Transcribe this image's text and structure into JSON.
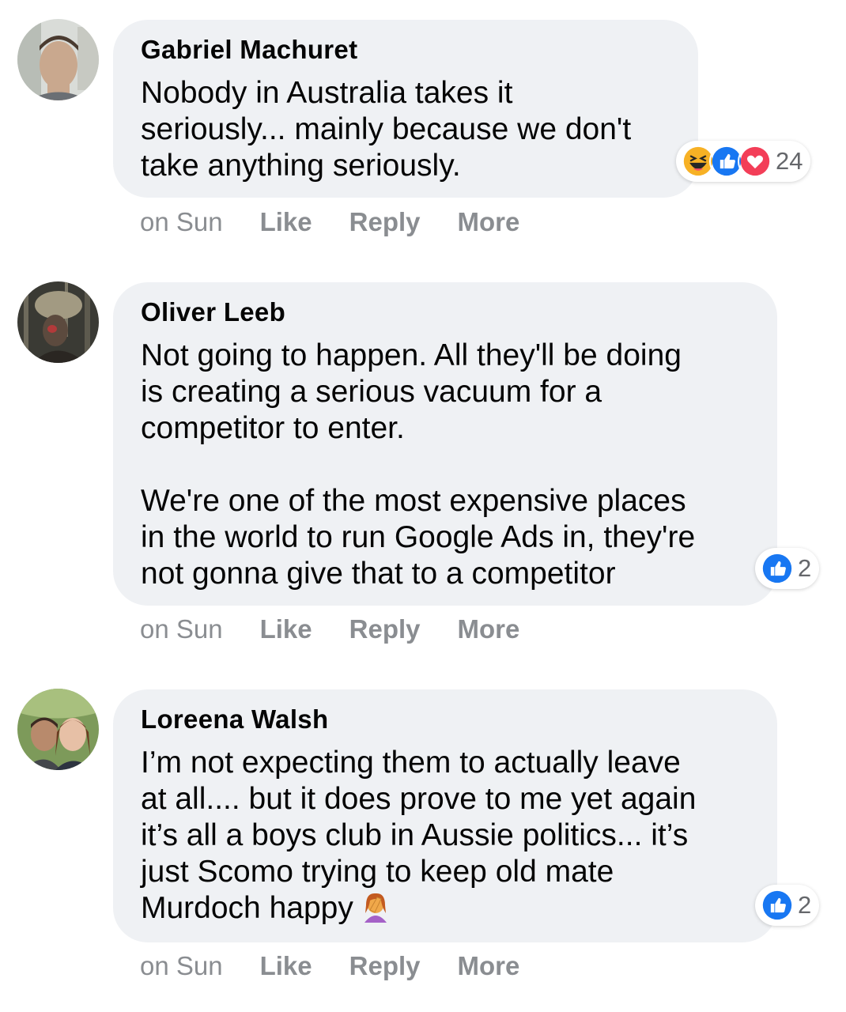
{
  "comments": [
    {
      "author": "Gabriel Machuret",
      "body": "Nobody in Australia takes it\nseriously... mainly because we don't\ntake anything seriously.",
      "time": "on Sun",
      "like": "Like",
      "reply": "Reply",
      "more": "More",
      "reaction_count": "24",
      "reaction_icons": [
        "haha-icon",
        "like-icon",
        "love-icon"
      ]
    },
    {
      "author": "Oliver Leeb",
      "body": "Not going to happen. All they'll be doing\nis creating a serious vacuum for a\ncompetitor to enter.\n\nWe're one of the most expensive places\nin the world to run Google Ads in, they're\nnot gonna give that to a competitor",
      "time": "on Sun",
      "like": "Like",
      "reply": "Reply",
      "more": "More",
      "reaction_count": "2",
      "reaction_icons": [
        "like-icon"
      ]
    },
    {
      "author": "Loreena Walsh",
      "body": "I’m not expecting them to actually leave\nat all.... but it does prove to me yet again\nit’s all a boys club in Aussie politics... it’s\njust Scomo trying to keep old mate\nMurdoch happy",
      "body_emoji": "woman-facepalming-icon",
      "time": "on Sun",
      "like": "Like",
      "reply": "Reply",
      "more": "More",
      "reaction_count": "2",
      "reaction_icons": [
        "like-icon"
      ]
    }
  ],
  "colors": {
    "bubble": "#eff1f4",
    "action_text": "#8a8d91",
    "like_blue": "#1877f2",
    "love_red": "#f33e58",
    "haha_yellow": "#f7b125"
  }
}
